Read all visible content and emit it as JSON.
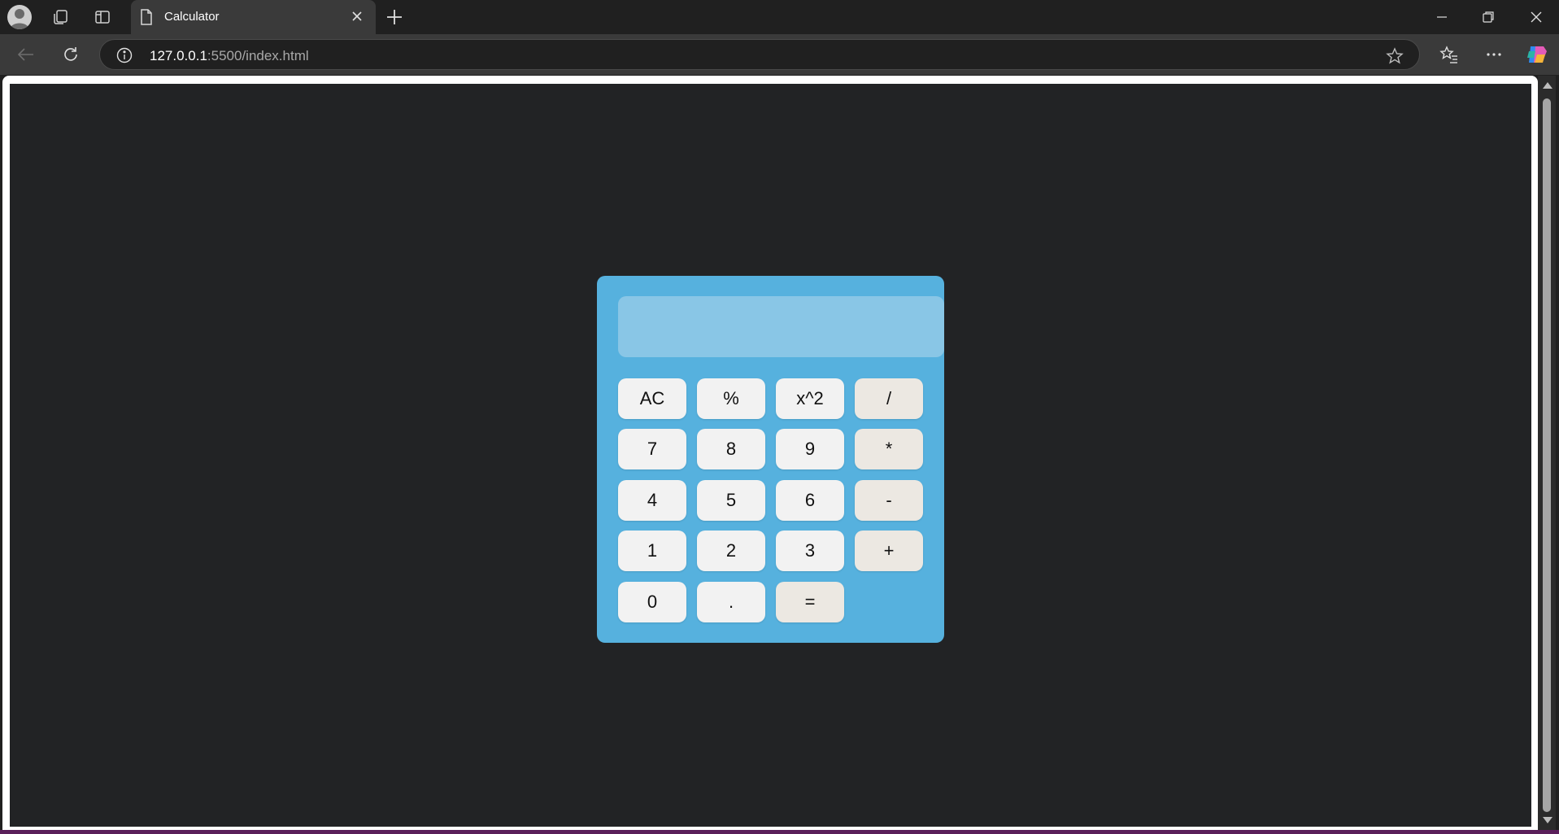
{
  "browser": {
    "tab_title": "Calculator",
    "url_host": "127.0.0.1",
    "url_rest": ":5500/index.html",
    "icons": [
      "profile-avatar-icon",
      "workspaces-icon",
      "vertical-tabs-icon",
      "page-icon",
      "close-icon",
      "plus-icon",
      "minimize-icon",
      "restore-icon",
      "close-window-icon",
      "back-arrow-icon",
      "refresh-icon",
      "site-info-icon",
      "star-icon",
      "favorites-icon",
      "more-icon",
      "copilot-icon"
    ]
  },
  "calculator": {
    "display_value": "",
    "colors": {
      "page_background": "#222325",
      "body": "#56b1de",
      "display": "#89c6e6",
      "key": "#f2f2f2",
      "operator_key": "#ece8e2"
    },
    "keys": {
      "ac": "AC",
      "percent": "%",
      "square": "x^2",
      "divide": "/",
      "seven": "7",
      "eight": "8",
      "nine": "9",
      "multiply": "*",
      "four": "4",
      "five": "5",
      "six": "6",
      "minus": "-",
      "one": "1",
      "two": "2",
      "three": "3",
      "plus": "+",
      "zero": "0",
      "decimal": ".",
      "equals": "="
    }
  }
}
